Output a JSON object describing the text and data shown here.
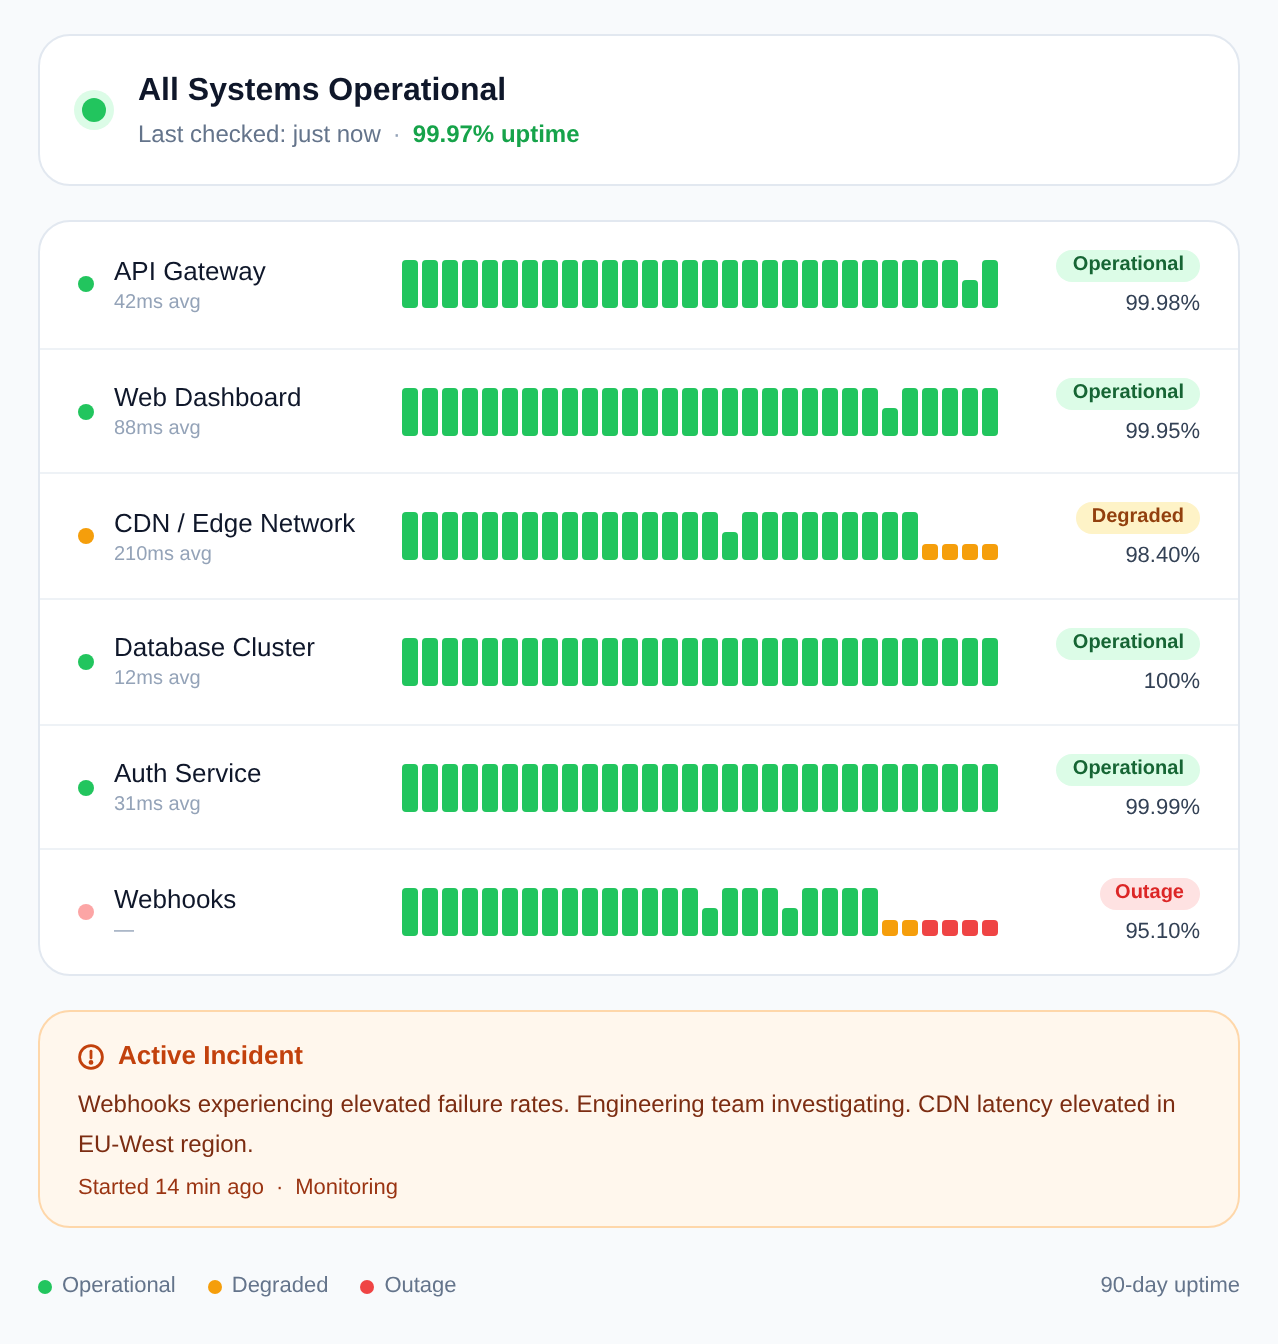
{
  "header": {
    "kind": "operational",
    "title": "All Systems Operational",
    "checked": "Last checked: just now",
    "separator": "·",
    "uptime": "99.97% uptime"
  },
  "services": [
    {
      "name": "API Gateway",
      "latency": "42ms avg",
      "kind": "operational",
      "badge": "Operational",
      "uptime": "99.98%",
      "history": [
        {
          "kind": "up"
        },
        {
          "kind": "up"
        },
        {
          "kind": "up"
        },
        {
          "kind": "up"
        },
        {
          "kind": "up"
        },
        {
          "kind": "up"
        },
        {
          "kind": "up"
        },
        {
          "kind": "up"
        },
        {
          "kind": "up"
        },
        {
          "kind": "up"
        },
        {
          "kind": "up"
        },
        {
          "kind": "up"
        },
        {
          "kind": "up"
        },
        {
          "kind": "up"
        },
        {
          "kind": "up"
        },
        {
          "kind": "up"
        },
        {
          "kind": "up"
        },
        {
          "kind": "up"
        },
        {
          "kind": "up"
        },
        {
          "kind": "up"
        },
        {
          "kind": "up"
        },
        {
          "kind": "up"
        },
        {
          "kind": "up"
        },
        {
          "kind": "up"
        },
        {
          "kind": "up"
        },
        {
          "kind": "up"
        },
        {
          "kind": "up"
        },
        {
          "kind": "up"
        },
        {
          "kind": "partial"
        },
        {
          "kind": "up"
        }
      ]
    },
    {
      "name": "Web Dashboard",
      "latency": "88ms avg",
      "kind": "operational",
      "badge": "Operational",
      "uptime": "99.95%",
      "history": [
        {
          "kind": "up"
        },
        {
          "kind": "up"
        },
        {
          "kind": "up"
        },
        {
          "kind": "up"
        },
        {
          "kind": "up"
        },
        {
          "kind": "up"
        },
        {
          "kind": "up"
        },
        {
          "kind": "up"
        },
        {
          "kind": "up"
        },
        {
          "kind": "up"
        },
        {
          "kind": "up"
        },
        {
          "kind": "up"
        },
        {
          "kind": "up"
        },
        {
          "kind": "up"
        },
        {
          "kind": "up"
        },
        {
          "kind": "up"
        },
        {
          "kind": "up"
        },
        {
          "kind": "up"
        },
        {
          "kind": "up"
        },
        {
          "kind": "up"
        },
        {
          "kind": "up"
        },
        {
          "kind": "up"
        },
        {
          "kind": "up"
        },
        {
          "kind": "up"
        },
        {
          "kind": "partial"
        },
        {
          "kind": "up"
        },
        {
          "kind": "up"
        },
        {
          "kind": "up"
        },
        {
          "kind": "up"
        },
        {
          "kind": "up"
        }
      ]
    },
    {
      "name": "CDN / Edge Network",
      "latency": "210ms avg",
      "kind": "degraded",
      "badge": "Degraded",
      "uptime": "98.40%",
      "history": [
        {
          "kind": "up"
        },
        {
          "kind": "up"
        },
        {
          "kind": "up"
        },
        {
          "kind": "up"
        },
        {
          "kind": "up"
        },
        {
          "kind": "up"
        },
        {
          "kind": "up"
        },
        {
          "kind": "up"
        },
        {
          "kind": "up"
        },
        {
          "kind": "up"
        },
        {
          "kind": "up"
        },
        {
          "kind": "up"
        },
        {
          "kind": "up"
        },
        {
          "kind": "up"
        },
        {
          "kind": "up"
        },
        {
          "kind": "up"
        },
        {
          "kind": "partial"
        },
        {
          "kind": "up"
        },
        {
          "kind": "up"
        },
        {
          "kind": "up"
        },
        {
          "kind": "up"
        },
        {
          "kind": "up"
        },
        {
          "kind": "up"
        },
        {
          "kind": "up"
        },
        {
          "kind": "up"
        },
        {
          "kind": "up"
        },
        {
          "kind": "degraded"
        },
        {
          "kind": "degraded"
        },
        {
          "kind": "degraded"
        },
        {
          "kind": "degraded"
        }
      ]
    },
    {
      "name": "Database Cluster",
      "latency": "12ms avg",
      "kind": "operational",
      "badge": "Operational",
      "uptime": "100%",
      "history": [
        {
          "kind": "up"
        },
        {
          "kind": "up"
        },
        {
          "kind": "up"
        },
        {
          "kind": "up"
        },
        {
          "kind": "up"
        },
        {
          "kind": "up"
        },
        {
          "kind": "up"
        },
        {
          "kind": "up"
        },
        {
          "kind": "up"
        },
        {
          "kind": "up"
        },
        {
          "kind": "up"
        },
        {
          "kind": "up"
        },
        {
          "kind": "up"
        },
        {
          "kind": "up"
        },
        {
          "kind": "up"
        },
        {
          "kind": "up"
        },
        {
          "kind": "up"
        },
        {
          "kind": "up"
        },
        {
          "kind": "up"
        },
        {
          "kind": "up"
        },
        {
          "kind": "up"
        },
        {
          "kind": "up"
        },
        {
          "kind": "up"
        },
        {
          "kind": "up"
        },
        {
          "kind": "up"
        },
        {
          "kind": "up"
        },
        {
          "kind": "up"
        },
        {
          "kind": "up"
        },
        {
          "kind": "up"
        },
        {
          "kind": "up"
        }
      ]
    },
    {
      "name": "Auth Service",
      "latency": "31ms avg",
      "kind": "operational",
      "badge": "Operational",
      "uptime": "99.99%",
      "history": [
        {
          "kind": "up"
        },
        {
          "kind": "up"
        },
        {
          "kind": "up"
        },
        {
          "kind": "up"
        },
        {
          "kind": "up"
        },
        {
          "kind": "up"
        },
        {
          "kind": "up"
        },
        {
          "kind": "up"
        },
        {
          "kind": "up"
        },
        {
          "kind": "up"
        },
        {
          "kind": "up"
        },
        {
          "kind": "up"
        },
        {
          "kind": "up"
        },
        {
          "kind": "up"
        },
        {
          "kind": "up"
        },
        {
          "kind": "up"
        },
        {
          "kind": "up"
        },
        {
          "kind": "up"
        },
        {
          "kind": "up"
        },
        {
          "kind": "up"
        },
        {
          "kind": "up"
        },
        {
          "kind": "up"
        },
        {
          "kind": "up"
        },
        {
          "kind": "up"
        },
        {
          "kind": "up"
        },
        {
          "kind": "up"
        },
        {
          "kind": "up"
        },
        {
          "kind": "up"
        },
        {
          "kind": "up"
        },
        {
          "kind": "up"
        }
      ]
    },
    {
      "name": "Webhooks",
      "latency": "—",
      "kind": "outage",
      "badge": "Outage",
      "uptime": "95.10%",
      "history": [
        {
          "kind": "up"
        },
        {
          "kind": "up"
        },
        {
          "kind": "up"
        },
        {
          "kind": "up"
        },
        {
          "kind": "up"
        },
        {
          "kind": "up"
        },
        {
          "kind": "up"
        },
        {
          "kind": "up"
        },
        {
          "kind": "up"
        },
        {
          "kind": "up"
        },
        {
          "kind": "up"
        },
        {
          "kind": "up"
        },
        {
          "kind": "up"
        },
        {
          "kind": "up"
        },
        {
          "kind": "up"
        },
        {
          "kind": "partial"
        },
        {
          "kind": "up"
        },
        {
          "kind": "up"
        },
        {
          "kind": "up"
        },
        {
          "kind": "partial"
        },
        {
          "kind": "up"
        },
        {
          "kind": "up"
        },
        {
          "kind": "up"
        },
        {
          "kind": "up"
        },
        {
          "kind": "degraded"
        },
        {
          "kind": "degraded"
        },
        {
          "kind": "outage"
        },
        {
          "kind": "outage"
        },
        {
          "kind": "outage"
        },
        {
          "kind": "outage"
        }
      ]
    }
  ],
  "incident": {
    "title": "Active Incident",
    "body": "Webhooks experiencing elevated failure rates. Engineering team investigating. CDN latency elevated in EU-West region.",
    "started": "Started 14 min ago",
    "separator": "·",
    "state": "Monitoring"
  },
  "legend": [
    {
      "label": "Operational",
      "color": "#22c55e"
    },
    {
      "label": "Degraded",
      "color": "#f59e0b"
    },
    {
      "label": "Outage",
      "color": "#ef4444"
    }
  ],
  "footer_note": "90-day uptime"
}
